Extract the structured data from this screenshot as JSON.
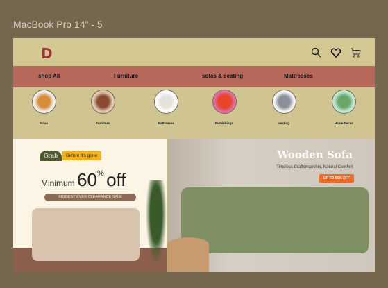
{
  "frame_title": "MacBook Pro 14\" - 5",
  "header": {
    "logo": "D",
    "icons": [
      "search-icon",
      "heart-icon",
      "cart-icon"
    ]
  },
  "nav": [
    "shop All",
    "Furniture",
    "sofas & seating",
    "Mattresses"
  ],
  "categories": [
    {
      "label": "Sofas",
      "color": "#d98a3a"
    },
    {
      "label": "Furniture",
      "color": "#8a4a30"
    },
    {
      "label": "Mattresses",
      "color": "#eeeeea"
    },
    {
      "label": "Furnishings",
      "color": "#e8462a"
    },
    {
      "label": "seating",
      "color": "#8a909a"
    },
    {
      "label": "Home Decor",
      "color": "#6aa56a"
    }
  ],
  "banner_left": {
    "grab": "Grab",
    "before": "Before it's gone",
    "minimum": "Minimum",
    "amount": "60",
    "pct": "%",
    "off": "off",
    "clearance": "BIGGEST EVER CLEARANCE SALE"
  },
  "banner_right": {
    "title": "Wooden Sofa",
    "subtitle": "Timeless Craftsmanship, Natural Comfort",
    "badge": "UP TO 55% OFF"
  }
}
